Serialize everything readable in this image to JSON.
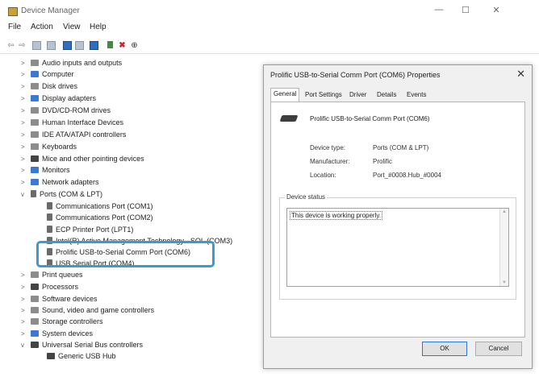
{
  "window": {
    "title": "Device Manager"
  },
  "window_controls": {
    "minimize": "—",
    "maximize": "☐",
    "close": "✕"
  },
  "menu": [
    "File",
    "Action",
    "View",
    "Help"
  ],
  "toolbar": {
    "icons": [
      "back-arrow-icon",
      "forward-arrow-icon",
      "properties-icon",
      "device-list-icon",
      "help-icon",
      "view-icon",
      "monitor-icon",
      "update-driver-icon",
      "remove-icon",
      "scan-icon"
    ],
    "remove_glyph": "✖",
    "scan_glyph": "⊕"
  },
  "tree": {
    "items": [
      {
        "label": "Audio inputs and outputs",
        "expand": ">"
      },
      {
        "label": "Computer",
        "expand": ">"
      },
      {
        "label": "Disk drives",
        "expand": ">"
      },
      {
        "label": "Display adapters",
        "expand": ">"
      },
      {
        "label": "DVD/CD-ROM drives",
        "expand": ">"
      },
      {
        "label": "Human Interface Devices",
        "expand": ">"
      },
      {
        "label": "IDE ATA/ATAPI controllers",
        "expand": ">"
      },
      {
        "label": "Keyboards",
        "expand": ">"
      },
      {
        "label": "Mice and other pointing devices",
        "expand": ">"
      },
      {
        "label": "Monitors",
        "expand": ">"
      },
      {
        "label": "Network adapters",
        "expand": ">"
      },
      {
        "label": "Ports (COM & LPT)",
        "expand": "v"
      },
      {
        "label": "Communications Port (COM1)",
        "expand": ""
      },
      {
        "label": "Communications Port (COM2)",
        "expand": ""
      },
      {
        "label": "ECP Printer Port (LPT1)",
        "expand": ""
      },
      {
        "label": "Intel(R) Active Management Technology - SOL (COM3)",
        "expand": ""
      },
      {
        "label": "Prolific USB-to-Serial Comm Port (COM6)",
        "expand": ""
      },
      {
        "label": "USB Serial Port (COM4)",
        "expand": ""
      },
      {
        "label": "Print queues",
        "expand": ">"
      },
      {
        "label": "Processors",
        "expand": ">"
      },
      {
        "label": "Software devices",
        "expand": ">"
      },
      {
        "label": "Sound, video and game controllers",
        "expand": ">"
      },
      {
        "label": "Storage controllers",
        "expand": ">"
      },
      {
        "label": "System devices",
        "expand": ">"
      },
      {
        "label": "Universal Serial Bus controllers",
        "expand": "v"
      },
      {
        "label": "Generic USB Hub",
        "expand": ""
      }
    ]
  },
  "dialog": {
    "title": "Prolific USB-to-Serial Comm Port (COM6) Properties",
    "close": "✕",
    "tabs": [
      "General",
      "Port Settings",
      "Driver",
      "Details",
      "Events"
    ],
    "active_tab": "General",
    "device_name": "Prolific USB-to-Serial Comm Port (COM6)",
    "props": [
      {
        "key": "Device type:",
        "value": "Ports (COM & LPT)"
      },
      {
        "key": "Manufacturer:",
        "value": "Prolific"
      },
      {
        "key": "Location:",
        "value": "Port_#0008.Hub_#0004"
      }
    ],
    "status_label": "Device status",
    "status_text": "This device is working properly.",
    "ok_label": "OK",
    "cancel_label": "Cancel"
  }
}
